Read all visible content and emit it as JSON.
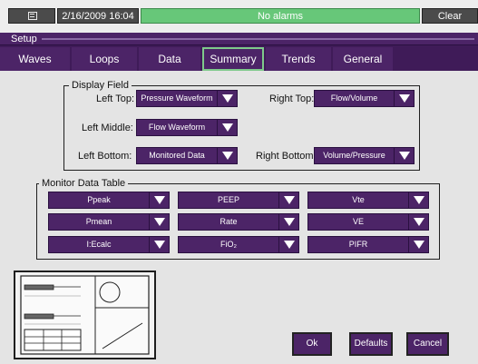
{
  "statusbar": {
    "date_time": "2/16/2009 16:04",
    "alarm_text": "No alarms",
    "alarm_color": "#67c779",
    "clear_label": "Clear"
  },
  "header": {
    "title": "Setup"
  },
  "tabs": [
    {
      "label": "Waves",
      "active": false
    },
    {
      "label": "Loops",
      "active": false
    },
    {
      "label": "Data",
      "active": false
    },
    {
      "label": "Summary",
      "active": true
    },
    {
      "label": "Trends",
      "active": false
    },
    {
      "label": "General",
      "active": false
    }
  ],
  "display_field": {
    "title": "Display Field",
    "left_top": {
      "label": "Left Top:",
      "value": "Pressure Waveform"
    },
    "left_middle": {
      "label": "Left Middle:",
      "value": "Flow Waveform"
    },
    "left_bottom": {
      "label": "Left Bottom:",
      "value": "Monitored Data"
    },
    "right_top": {
      "label": "Right Top:",
      "value": "Flow/Volume"
    },
    "right_bottom": {
      "label": "Right Bottom:",
      "value": "Volume/Pressure"
    }
  },
  "monitor_table": {
    "title": "Monitor Data Table",
    "cells": [
      "Ppeak",
      "PEEP",
      "Vte",
      "Pmean",
      "Rate",
      "VE",
      "I:Ecalc",
      "FiO₂",
      "PIFR"
    ]
  },
  "buttons": {
    "ok": "Ok",
    "defaults": "Defaults",
    "cancel": "Cancel"
  },
  "colors": {
    "accent": "#4c2467",
    "active_tab_border": "#7fc98b",
    "background": "#e4e4e4"
  }
}
